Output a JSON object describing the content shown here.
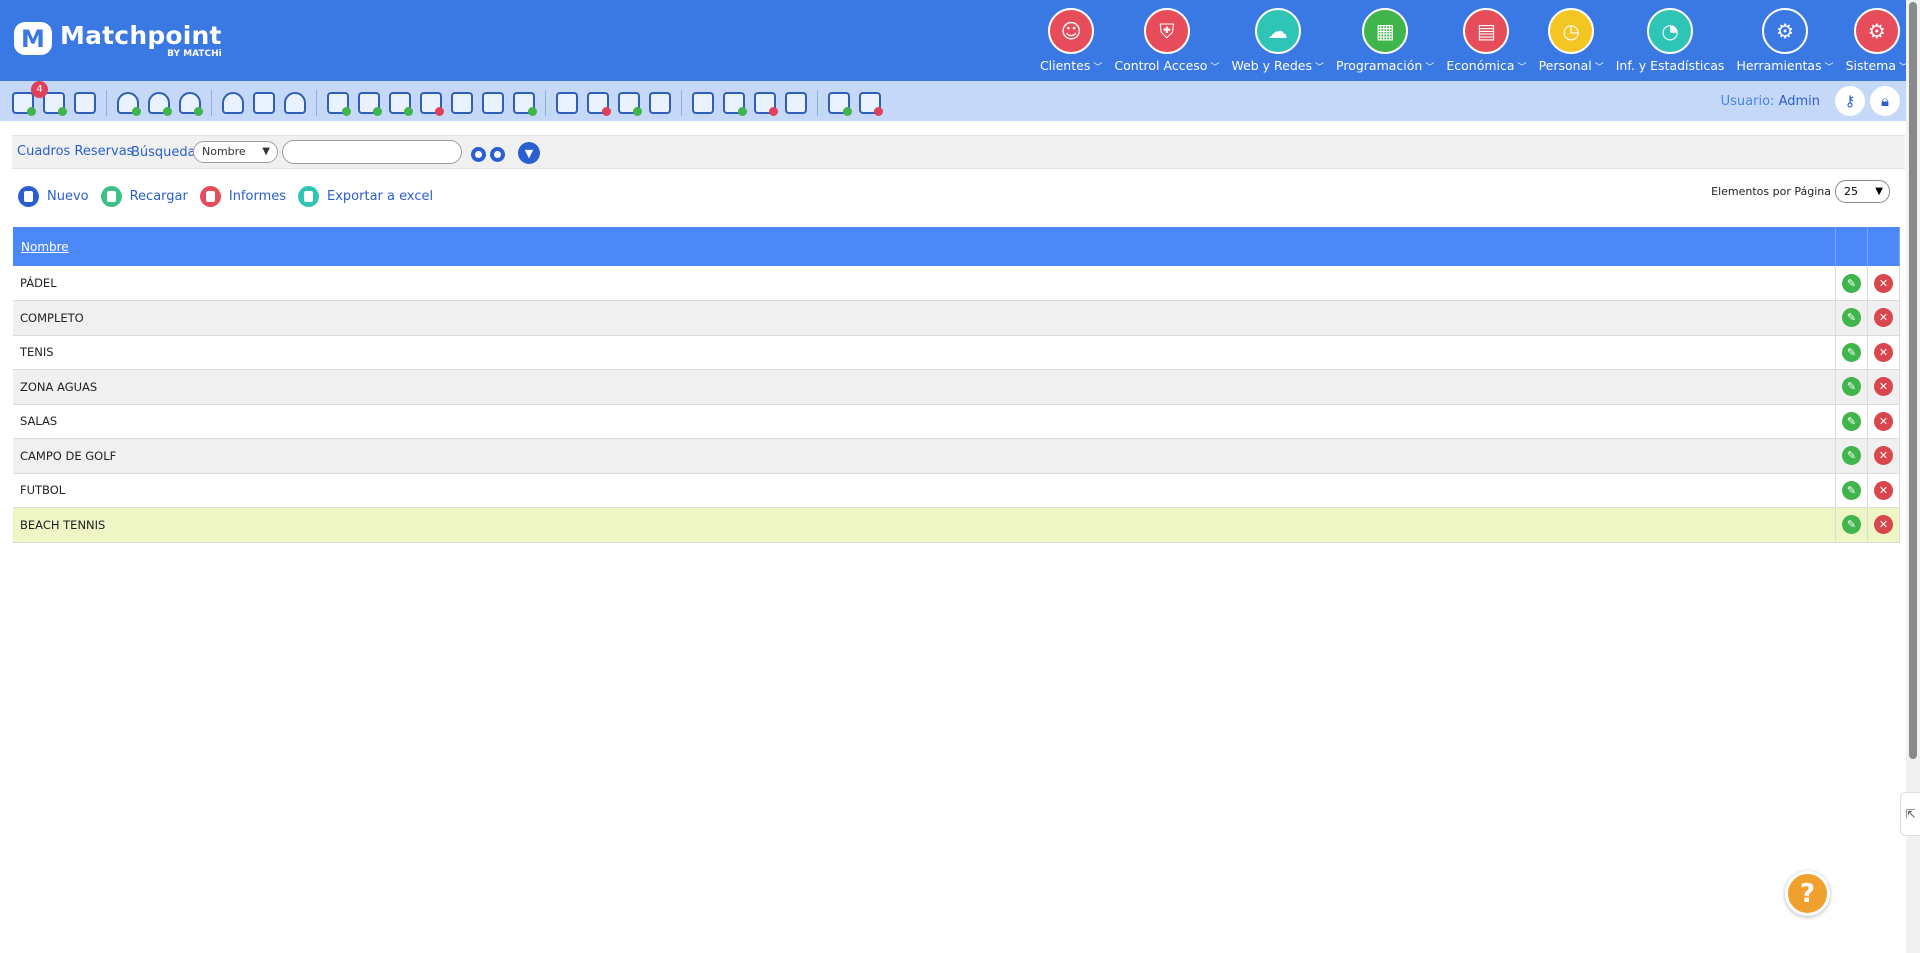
{
  "brand": {
    "name": "Matchpoint",
    "mark": "M",
    "sub": "BY MATCHi"
  },
  "nav": [
    {
      "label": "Clientes",
      "icon": "clientes-icon",
      "color": "#e74c5a",
      "glyph": "☺"
    },
    {
      "label": "Control Acceso",
      "icon": "shield-icon",
      "color": "#e74c5a",
      "glyph": "⛨"
    },
    {
      "label": "Web y Redes",
      "icon": "cloud-icon",
      "color": "#2ec4b6",
      "glyph": "☁"
    },
    {
      "label": "Programación",
      "icon": "calendar-icon",
      "color": "#3fb54b",
      "glyph": "▦"
    },
    {
      "label": "Económica",
      "icon": "calculator-icon",
      "color": "#e74c5a",
      "glyph": "▤"
    },
    {
      "label": "Personal",
      "icon": "staff-icon",
      "color": "#f3c623",
      "glyph": "◷"
    },
    {
      "label": "Inf. y Estadísticas",
      "icon": "stats-icon",
      "color": "#2ec4b6",
      "glyph": "◔"
    },
    {
      "label": "Herramientas",
      "icon": "tools-icon",
      "color": "#3a78e4",
      "glyph": "⚙"
    },
    {
      "label": "Sistema",
      "icon": "system-icon",
      "color": "#e74c5a",
      "glyph": "⚙"
    }
  ],
  "toolbar": {
    "badge": "4",
    "user_prefix": "Usuario:",
    "user_name": "Admin"
  },
  "search": {
    "title": "Cuadros Reservas",
    "label": "Búsqueda",
    "field": "Nombre",
    "value": ""
  },
  "actions": [
    {
      "label": "Nuevo",
      "color": "#2a5fd0"
    },
    {
      "label": "Recargar",
      "color": "#3fbf8a"
    },
    {
      "label": "Informes",
      "color": "#e74c5a"
    },
    {
      "label": "Exportar a excel",
      "color": "#2ec4b6"
    }
  ],
  "pagination": {
    "label": "Elementos por Página",
    "value": "25"
  },
  "table": {
    "header": "Nombre",
    "rows": [
      "PÁDEL",
      "COMPLETO",
      "TENIS",
      "ZONA AGUAS",
      "SALAS",
      "CAMPO DE GOLF",
      "FUTBOL",
      "BEACH TENNIS"
    ]
  },
  "help": "?"
}
